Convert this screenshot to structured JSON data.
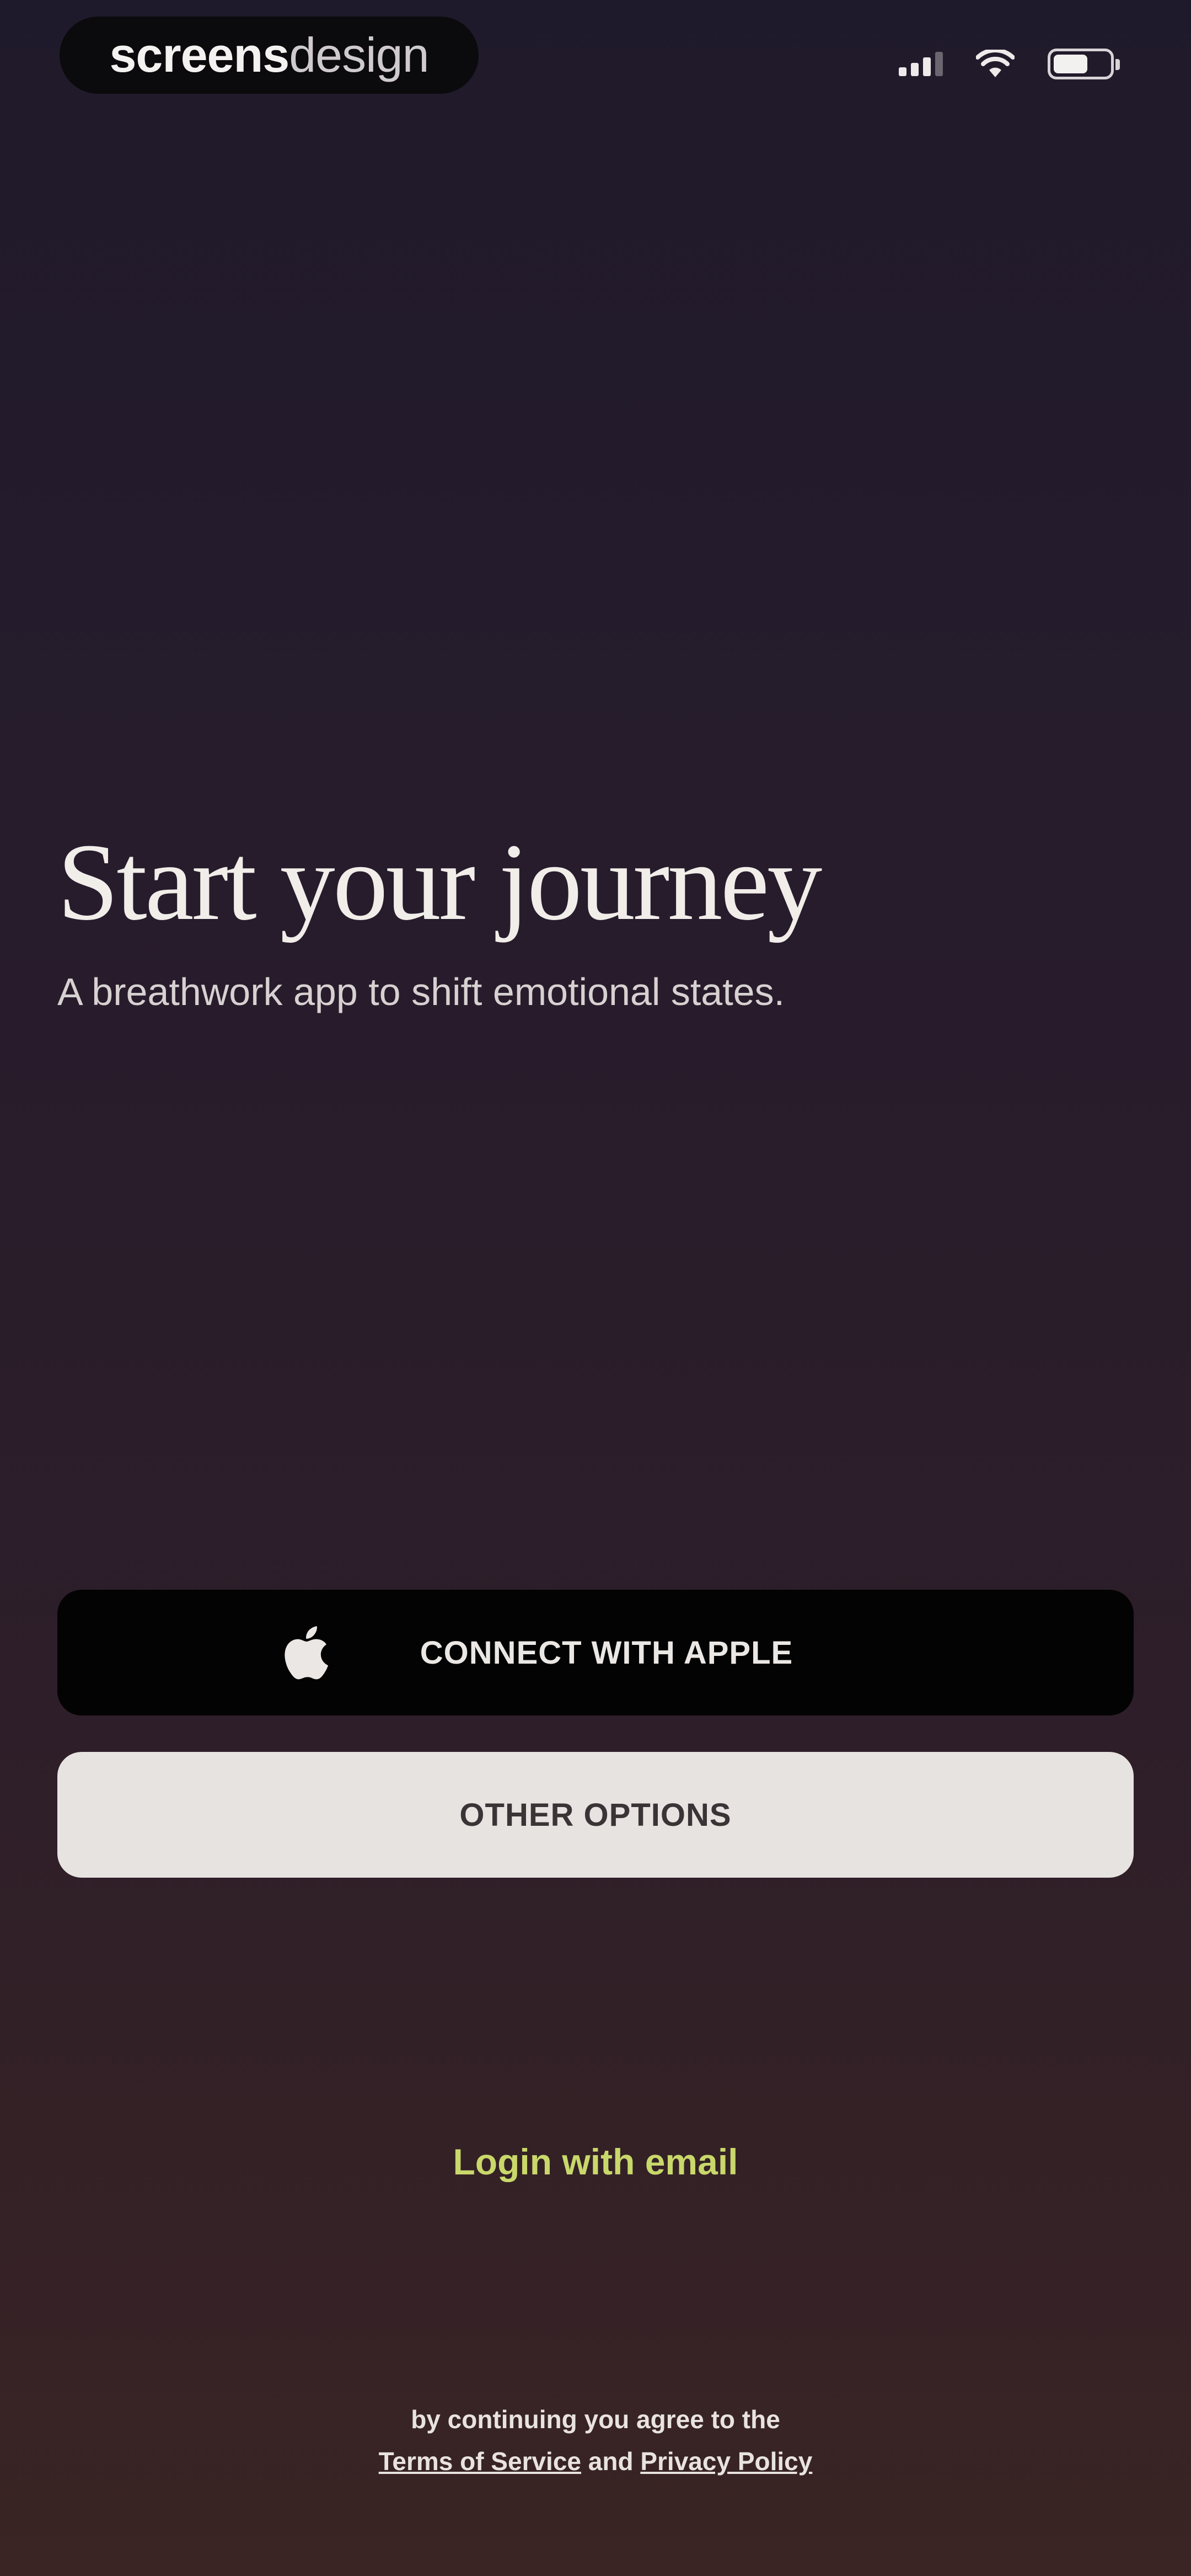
{
  "watermark": {
    "strong": "screens",
    "light": "design"
  },
  "status_bar": {
    "icons": [
      "signal-icon",
      "wifi-icon",
      "battery-icon"
    ],
    "battery_level": 0.62
  },
  "hero": {
    "title": "Start your journey",
    "subtitle": "A breathwork app to shift emotional states."
  },
  "buttons": {
    "apple_label": "CONNECT WITH APPLE",
    "apple_icon": "apple-icon",
    "other_label": "OTHER OPTIONS"
  },
  "login": {
    "email_label": "Login with email"
  },
  "legal": {
    "prefix": "by continuing you agree to the",
    "terms": "Terms of Service",
    "and": " and ",
    "privacy": "Privacy Policy"
  },
  "colors": {
    "accent": "#c9d86a",
    "background_top": "#1f1a2b",
    "background_bottom": "#3a2424",
    "apple_button": "#030303",
    "other_button": "#e7e3e1"
  }
}
